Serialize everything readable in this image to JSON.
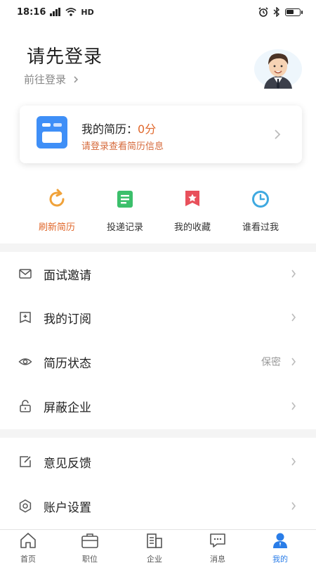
{
  "status_bar": {
    "time": "18:16",
    "network": "HD",
    "icons": [
      "signal-icon",
      "wifi-icon",
      "alarm-icon",
      "bluetooth-icon",
      "battery-icon"
    ],
    "battery_level": 0.6
  },
  "header": {
    "title": "请先登录",
    "login_link": "前往登录"
  },
  "resume_card": {
    "title_prefix": "我的简历：",
    "score": "0分",
    "subtitle": "请登录查看简历信息"
  },
  "quick_actions": [
    {
      "label": "刷新简历",
      "icon": "refresh-icon"
    },
    {
      "label": "投递记录",
      "icon": "delivery-record-icon"
    },
    {
      "label": "我的收藏",
      "icon": "favorite-icon"
    },
    {
      "label": "谁看过我",
      "icon": "clock-icon"
    }
  ],
  "menu": [
    {
      "label": "面试邀请",
      "icon": "mail-icon",
      "value": ""
    },
    {
      "label": "我的订阅",
      "icon": "subscribe-icon",
      "value": ""
    },
    {
      "label": "简历状态",
      "icon": "eye-icon",
      "value": "保密"
    },
    {
      "label": "屏蔽企业",
      "icon": "lock-icon",
      "value": ""
    },
    {
      "label": "意见反馈",
      "icon": "edit-icon",
      "value": ""
    },
    {
      "label": "账户设置",
      "icon": "settings-icon",
      "value": ""
    }
  ],
  "tabs": [
    {
      "label": "首页",
      "icon": "home-icon"
    },
    {
      "label": "职位",
      "icon": "briefcase-icon"
    },
    {
      "label": "企业",
      "icon": "building-icon"
    },
    {
      "label": "消息",
      "icon": "message-icon"
    },
    {
      "label": "我的",
      "icon": "profile-icon"
    }
  ],
  "colors": {
    "accent": "#e0672b",
    "brand_blue": "#2a7de8",
    "card_icon_blue": "#3f8ff7"
  }
}
